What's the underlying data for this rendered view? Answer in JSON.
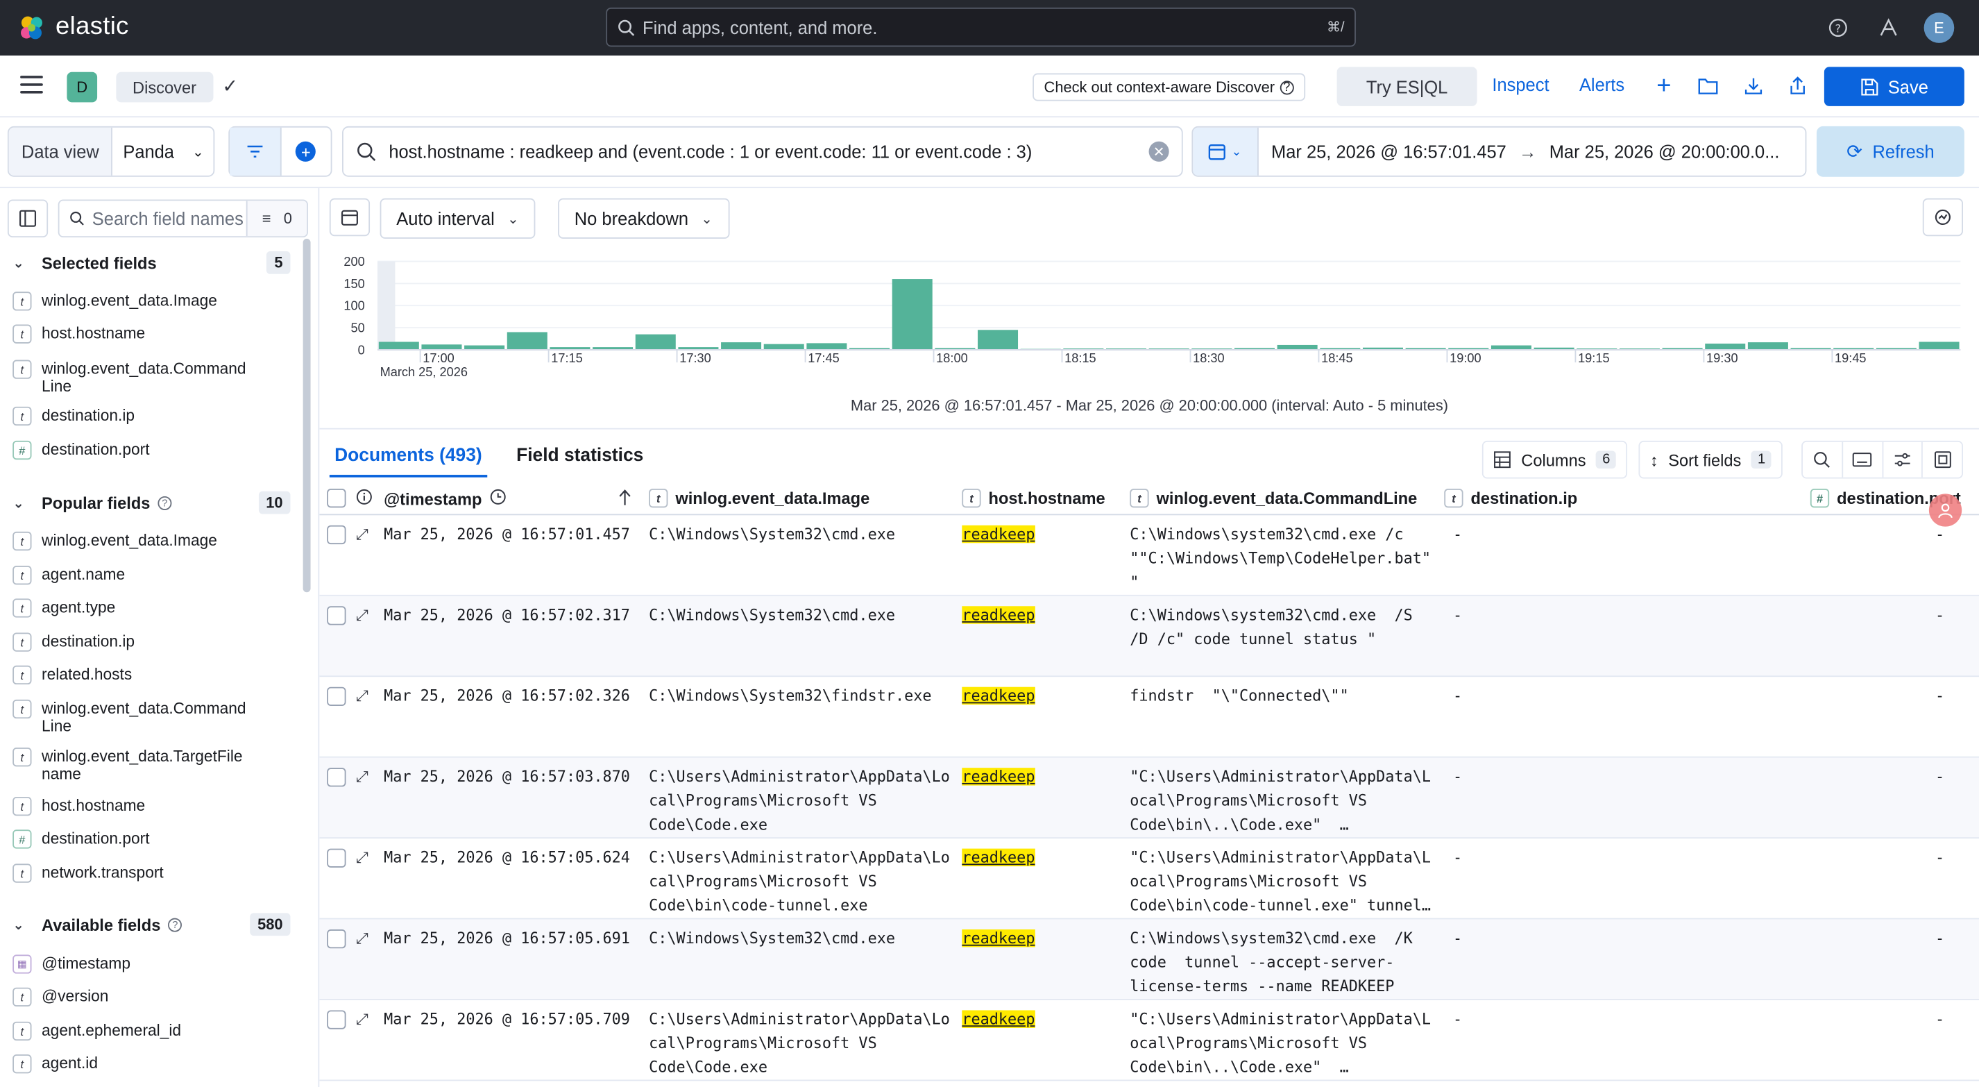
{
  "header": {
    "brand": "elastic",
    "search_placeholder": "Find apps, content, and more.",
    "search_shortcut": "⌘/",
    "avatar_initial": "E"
  },
  "appbar": {
    "space_initial": "D",
    "breadcrumb": "Discover",
    "context_aware_label": "Check out context-aware Discover",
    "try_esql_label": "Try ES|QL",
    "inspect_label": "Inspect",
    "alerts_label": "Alerts",
    "save_label": "Save"
  },
  "querybar": {
    "data_view_label": "Data view",
    "data_view_value": "Panda",
    "query": "host.hostname : readkeep and (event.code : 1 or event.code: 11 or event.code : 3)",
    "date_start": "Mar 25, 2026 @ 16:57:01.457",
    "date_end": "Mar 25, 2026 @ 20:00:00.0...",
    "refresh_label": "Refresh"
  },
  "sidebar": {
    "search_placeholder": "Search field names",
    "filter_count": "0",
    "selected": {
      "title": "Selected fields",
      "count": "5",
      "fields": [
        {
          "type": "t",
          "name": "winlog.event_data.Image"
        },
        {
          "type": "t",
          "name": "host.hostname"
        },
        {
          "type": "t",
          "name": "winlog.event_data.CommandLine"
        },
        {
          "type": "t",
          "name": "destination.ip"
        },
        {
          "type": "#",
          "name": "destination.port"
        }
      ]
    },
    "popular": {
      "title": "Popular fields",
      "count": "10",
      "fields": [
        {
          "type": "t",
          "name": "winlog.event_data.Image"
        },
        {
          "type": "t",
          "name": "agent.name"
        },
        {
          "type": "t",
          "name": "agent.type"
        },
        {
          "type": "t",
          "name": "destination.ip"
        },
        {
          "type": "t",
          "name": "related.hosts"
        },
        {
          "type": "t",
          "name": "winlog.event_data.CommandLine"
        },
        {
          "type": "t",
          "name": "winlog.event_data.TargetFilename"
        },
        {
          "type": "t",
          "name": "host.hostname"
        },
        {
          "type": "#",
          "name": "destination.port"
        },
        {
          "type": "t",
          "name": "network.transport"
        }
      ]
    },
    "available": {
      "title": "Available fields",
      "count": "580",
      "fields": [
        {
          "type": "date",
          "name": "@timestamp"
        },
        {
          "type": "t",
          "name": "@version"
        },
        {
          "type": "t",
          "name": "agent.ephemeral_id"
        },
        {
          "type": "t",
          "name": "agent.id"
        }
      ]
    }
  },
  "chart_toolbar": {
    "interval_label": "Auto interval",
    "breakdown_label": "No breakdown"
  },
  "chart_data": {
    "type": "bar",
    "color": "#54b399",
    "ylim": [
      0,
      200
    ],
    "yticks": [
      "0",
      "50",
      "100",
      "150",
      "200"
    ],
    "xticks": [
      {
        "label": "17:00",
        "sub": "March 25, 2026",
        "bin": 1
      },
      {
        "label": "17:15",
        "bin": 4
      },
      {
        "label": "17:30",
        "bin": 7
      },
      {
        "label": "17:45",
        "bin": 10
      },
      {
        "label": "18:00",
        "bin": 13
      },
      {
        "label": "18:15",
        "bin": 16
      },
      {
        "label": "18:30",
        "bin": 19
      },
      {
        "label": "18:45",
        "bin": 22
      },
      {
        "label": "19:00",
        "bin": 25
      },
      {
        "label": "19:15",
        "bin": 28
      },
      {
        "label": "19:30",
        "bin": 31
      },
      {
        "label": "19:45",
        "bin": 34
      }
    ],
    "values": [
      18,
      12,
      10,
      40,
      6,
      6,
      35,
      6,
      17,
      13,
      15,
      4,
      160,
      4,
      45,
      2,
      3,
      3,
      3,
      3,
      4,
      11,
      4,
      5,
      4,
      4,
      10,
      5,
      3,
      3,
      4,
      14,
      17,
      4,
      4,
      4,
      18
    ],
    "caption": "Mar 25, 2026 @ 16:57:01.457 - Mar 25, 2026 @ 20:00:00.000 (interval: Auto - 5 minutes)"
  },
  "tabs": {
    "documents": "Documents (493)",
    "field_stats": "Field statistics",
    "columns_label": "Columns",
    "columns_count": "6",
    "sort_label": "Sort fields",
    "sort_count": "1"
  },
  "grid": {
    "columns": [
      {
        "type": "",
        "name": "@timestamp"
      },
      {
        "type": "t",
        "name": "winlog.event_data.Image"
      },
      {
        "type": "t",
        "name": "host.hostname"
      },
      {
        "type": "t",
        "name": "winlog.event_data.CommandLine"
      },
      {
        "type": "t",
        "name": "destination.ip"
      },
      {
        "type": "#",
        "name": "destination.port"
      }
    ],
    "rows": [
      {
        "ts": "Mar 25, 2026 @ 16:57:01.457",
        "image": "C:\\Windows\\System32\\cmd.exe",
        "host": "readkeep",
        "cmd": "C:\\Windows\\system32\\cmd.exe /c\n\"\"C:\\Windows\\Temp\\CodeHelper.bat\"\n\"",
        "ip": "-",
        "port": "-",
        "h": 64
      },
      {
        "ts": "Mar 25, 2026 @ 16:57:02.317",
        "image": "C:\\Windows\\System32\\cmd.exe",
        "host": "readkeep",
        "cmd": "C:\\Windows\\system32\\cmd.exe  /S\n/D /c\" code tunnel status \"",
        "ip": "-",
        "port": "-",
        "h": 64
      },
      {
        "ts": "Mar 25, 2026 @ 16:57:02.326",
        "image": "C:\\Windows\\System32\\findstr.exe",
        "host": "readkeep",
        "cmd": "findstr  \"\\\"Connected\\\"\"",
        "ip": "-",
        "port": "-",
        "h": 64
      },
      {
        "ts": "Mar 25, 2026 @ 16:57:03.870",
        "image": "C:\\Users\\Administrator\\AppData\\Lo\ncal\\Programs\\Microsoft VS\nCode\\Code.exe",
        "host": "readkeep",
        "cmd": "\"C:\\Users\\Administrator\\AppData\\L\nocal\\Programs\\Microsoft VS\nCode\\bin\\..\\Code.exe\"  …",
        "ip": "-",
        "port": "-",
        "h": 64
      },
      {
        "ts": "Mar 25, 2026 @ 16:57:05.624",
        "image": "C:\\Users\\Administrator\\AppData\\Lo\ncal\\Programs\\Microsoft VS\nCode\\bin\\code-tunnel.exe",
        "host": "readkeep",
        "cmd": "\"C:\\Users\\Administrator\\AppData\\L\nocal\\Programs\\Microsoft VS\nCode\\bin\\code-tunnel.exe\" tunnel…",
        "ip": "-",
        "port": "-",
        "h": 64
      },
      {
        "ts": "Mar 25, 2026 @ 16:57:05.691",
        "image": "C:\\Windows\\System32\\cmd.exe",
        "host": "readkeep",
        "cmd": "C:\\Windows\\system32\\cmd.exe  /K\ncode  tunnel --accept-server-\nlicense-terms --name READKEEP",
        "ip": "-",
        "port": "-",
        "h": 64
      },
      {
        "ts": "Mar 25, 2026 @ 16:57:05.709",
        "image": "C:\\Users\\Administrator\\AppData\\Lo\ncal\\Programs\\Microsoft VS\nCode\\Code.exe",
        "host": "readkeep",
        "cmd": "\"C:\\Users\\Administrator\\AppData\\L\nocal\\Programs\\Microsoft VS\nCode\\bin\\..\\Code.exe\"  …",
        "ip": "-",
        "port": "-",
        "h": 64
      }
    ]
  }
}
